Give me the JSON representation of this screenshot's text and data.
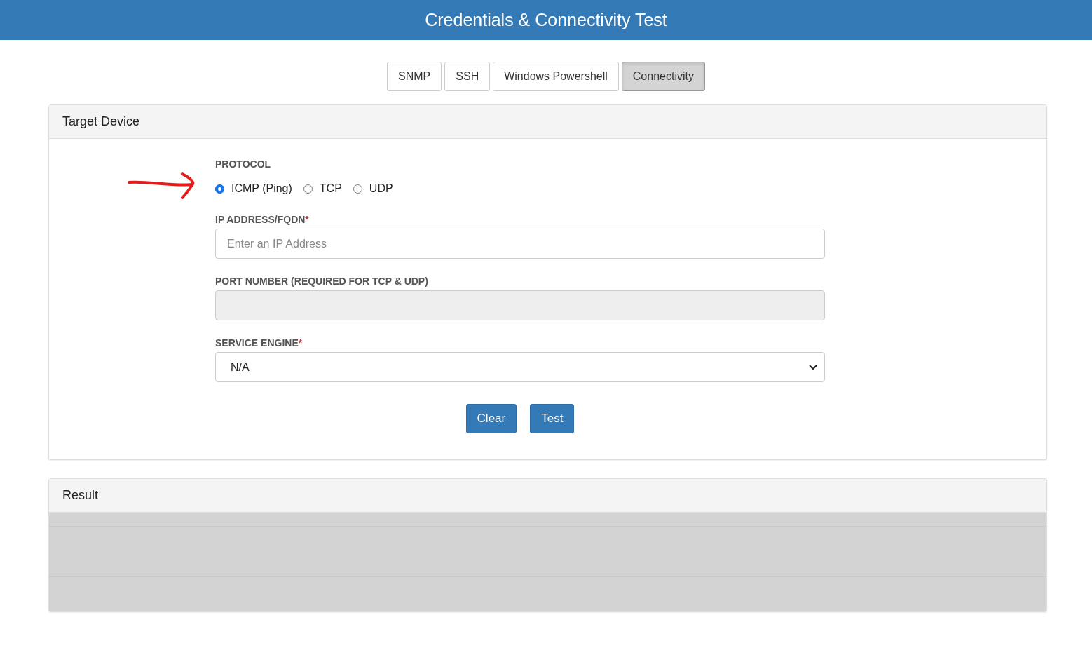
{
  "header": {
    "title": "Credentials & Connectivity Test"
  },
  "tabs": [
    {
      "label": "SNMP",
      "selected": false
    },
    {
      "label": "SSH",
      "selected": false
    },
    {
      "label": "Windows Powershell",
      "selected": false
    },
    {
      "label": "Connectivity",
      "selected": true
    }
  ],
  "target_panel": {
    "title": "Target Device",
    "fields": [
      {
        "kind": "radio",
        "label": "PROTOCOL",
        "options": [
          {
            "label": "ICMP (Ping)",
            "selected": true
          },
          {
            "label": "TCP",
            "selected": false
          },
          {
            "label": "UDP",
            "selected": false
          }
        ]
      },
      {
        "kind": "text",
        "label": "IP ADDRESS/FQDN",
        "required_mark": "*",
        "placeholder": "Enter an IP Address",
        "disabled": false
      },
      {
        "kind": "text",
        "label": "PORT NUMBER (REQUIRED FOR TCP & UDP)",
        "disabled": true
      },
      {
        "kind": "select",
        "label": "SERVICE ENGINE",
        "required_mark": "*",
        "value": "N/A"
      }
    ],
    "buttons": [
      "Clear",
      "Test"
    ]
  },
  "result_panel": {
    "title": "Result"
  }
}
